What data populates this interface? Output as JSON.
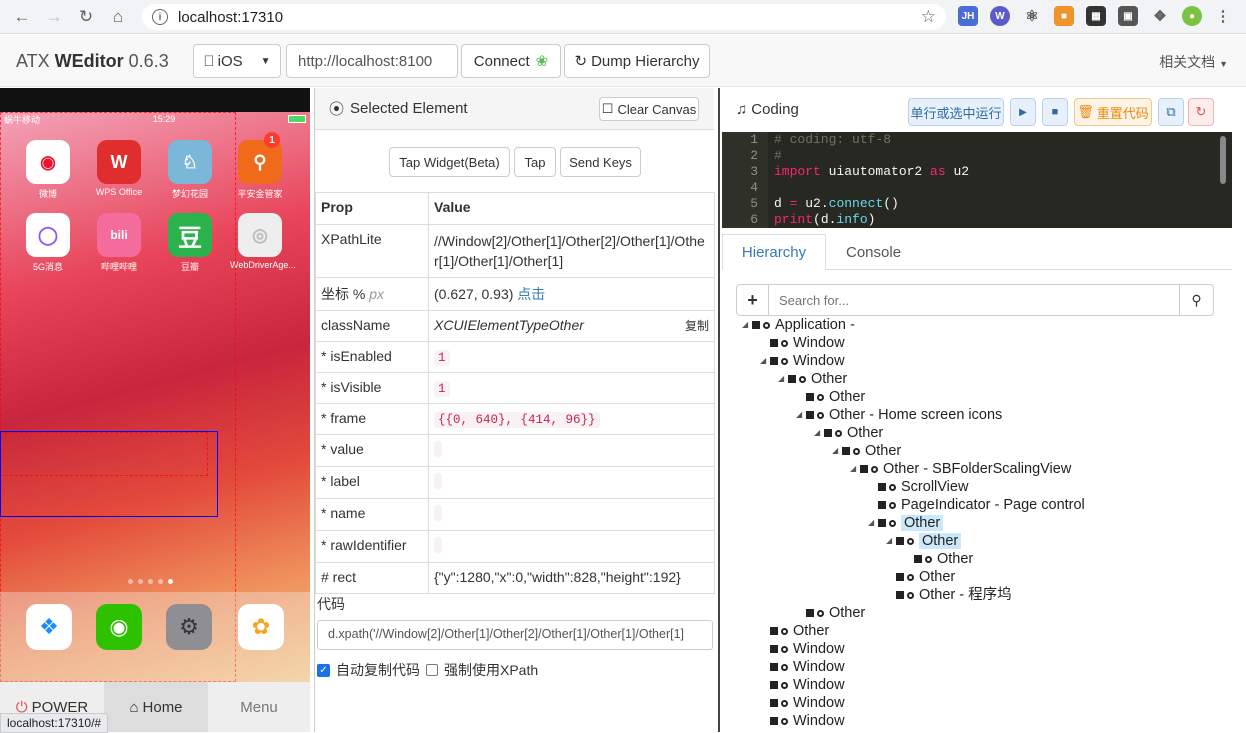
{
  "browser": {
    "url": "localhost:17310",
    "status_tip": "localhost:17310/#"
  },
  "app": {
    "brand_prefix": "ATX ",
    "brand_name": "WEditor",
    "version": " 0.6.3"
  },
  "toolbar": {
    "platform": "iOS",
    "device_url": "http://localhost:8100",
    "connect": "Connect",
    "dump": "Dump Hierarchy",
    "docs": "相关文档"
  },
  "phone": {
    "carrier": "蜗牛移动",
    "time": "15:29",
    "apps": [
      {
        "name": "微博"
      },
      {
        "name": "WPS Office"
      },
      {
        "name": "梦幻花园"
      },
      {
        "name": "平安金管家",
        "badge": "1"
      },
      {
        "name": "5G消息"
      },
      {
        "name": "哔哩哔哩"
      },
      {
        "name": "豆瓣"
      },
      {
        "name": "WebDriverAge..."
      }
    ],
    "buttons": {
      "power": "POWER",
      "home": "Home",
      "menu": "Menu"
    }
  },
  "selected": {
    "title": "Selected Element",
    "clear": "Clear Canvas",
    "tap_widget": "Tap Widget(Beta)",
    "tap": "Tap",
    "send_keys": "Send Keys",
    "head_prop": "Prop",
    "head_value": "Value",
    "xpath_label": "XPathLite",
    "xpath": "//Window[2]/Other[1]/Other[2]/Other[1]/Other[1]/Other[1]/Other[1]",
    "coord_label": "坐标 %",
    "coord_unit": "px",
    "coord": "(0.627, 0.93)",
    "coord_click": "点击",
    "class_label": "className",
    "class_value": "XCUIElementTypeOther",
    "copy": "复制",
    "enabled_label": "* isEnabled",
    "enabled": "1",
    "visible_label": "* isVisible",
    "visible": "1",
    "frame_label": "* frame",
    "frame": "{{0, 640}, {414, 96}}",
    "value_label": "* value",
    "label_label": "* label",
    "name_label": "* name",
    "rawid_label": "* rawIdentifier",
    "rect_label": "# rect",
    "rect": "{\"y\":1280,\"x\":0,\"width\":828,\"height\":192}",
    "code_title": "代码",
    "code": "d.xpath('//Window[2]/Other[1]/Other[2]/Other[1]/Other[1]/Other[1]",
    "auto_copy": "自动复制代码",
    "force_xpath": "强制使用XPath"
  },
  "coding": {
    "title": "Coding",
    "run_btn": "单行或选中运行",
    "reset_btn": "重置代码",
    "lines": [
      "# coding: utf-8",
      "#",
      "import uiautomator2 as u2",
      "",
      "d = u2.connect()",
      "print(d.info)"
    ],
    "line_numbers": [
      "1",
      "2",
      "3",
      "4",
      "5",
      "6"
    ]
  },
  "hierarchy": {
    "tab_hierarchy": "Hierarchy",
    "tab_console": "Console",
    "search_placeholder": "Search for...",
    "nodes": [
      "Application -",
      "Window",
      "Window",
      "Other",
      "Other",
      "Other - Home screen icons",
      "Other",
      "Other",
      "Other - SBFolderScalingView",
      "ScrollView",
      "PageIndicator - Page control",
      "Other",
      "Other",
      "Other",
      "Other",
      "Other - 程序坞",
      "Other",
      "Other",
      "Window",
      "Window",
      "Window",
      "Window",
      "Window"
    ]
  }
}
